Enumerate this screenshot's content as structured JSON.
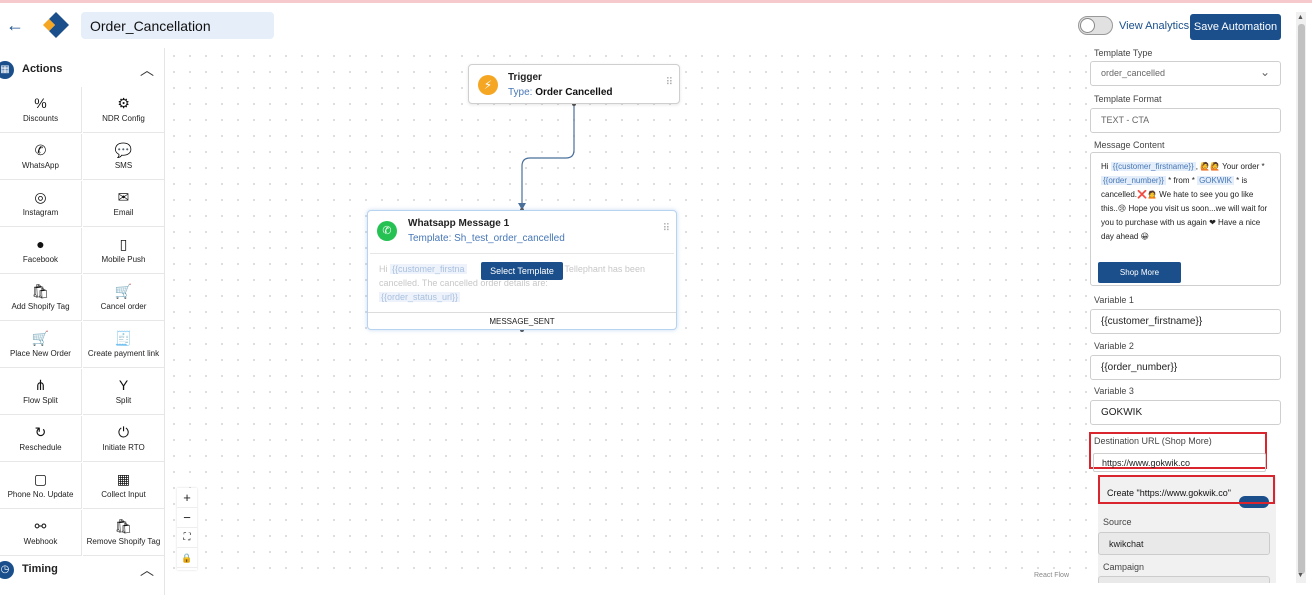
{
  "header": {
    "automation_name": "Order_Cancellation",
    "view_analytics": "View Analytics",
    "save_button": "Save Automation"
  },
  "sidebar": {
    "actions_title": "Actions",
    "timing_title": "Timing",
    "items": [
      {
        "label": "Discounts",
        "icon": "percent-icon"
      },
      {
        "label": "NDR Config",
        "icon": "gear-icon"
      },
      {
        "label": "WhatsApp",
        "icon": "whatsapp-icon"
      },
      {
        "label": "SMS",
        "icon": "sms-icon"
      },
      {
        "label": "Instagram",
        "icon": "instagram-icon"
      },
      {
        "label": "Email",
        "icon": "email-icon"
      },
      {
        "label": "Facebook",
        "icon": "facebook-icon"
      },
      {
        "label": "Mobile Push",
        "icon": "mobile-push-icon"
      },
      {
        "label": "Add Shopify Tag",
        "icon": "shopify-icon"
      },
      {
        "label": "Cancel order",
        "icon": "cart-cancel-icon"
      },
      {
        "label": "Place New Order",
        "icon": "cart-icon"
      },
      {
        "label": "Create payment link",
        "icon": "payment-link-icon"
      },
      {
        "label": "Flow Split",
        "icon": "flow-split-icon"
      },
      {
        "label": "Split",
        "icon": "split-icon"
      },
      {
        "label": "Reschedule",
        "icon": "reschedule-icon"
      },
      {
        "label": "Initiate RTO",
        "icon": "power-icon"
      },
      {
        "label": "Phone No. Update",
        "icon": "phone-update-icon"
      },
      {
        "label": "Collect Input",
        "icon": "grid-icon"
      },
      {
        "label": "Webhook",
        "icon": "webhook-icon"
      },
      {
        "label": "Remove Shopify Tag",
        "icon": "shopify-icon"
      }
    ]
  },
  "canvas": {
    "trigger": {
      "title": "Trigger",
      "type_label": "Type:",
      "type_value": "Order Cancelled"
    },
    "whatsapp_node": {
      "title": "Whatsapp Message 1",
      "template_label": "Template:",
      "template_value": "Sh_test_order_cancelled",
      "body_1": "Hi ",
      "var_1": "{{customer_firstna",
      "body_2": "om Tellephant has been cancelled. The cancelled order details are:",
      "var_2": "{{order_status_url}}",
      "select_button": "Select Template",
      "footer": "MESSAGE_SENT"
    },
    "zoom_controls": [
      "+",
      "−",
      "⛶",
      "🔒"
    ],
    "attribution": "React Flow"
  },
  "panel": {
    "template_type_label": "Template Type",
    "template_type_value": "order_cancelled",
    "template_format_label": "Template Format",
    "template_format_value": "TEXT - CTA",
    "message_content_label": "Message Content",
    "message": {
      "p1": "Hi ",
      "v1": "{{customer_firstname}}",
      "p2": ", 🙋🙋 Your order * ",
      "v2": "{{order_number}}",
      "p3": " * from * ",
      "v3": "GOKWIK",
      "p4": " * is cancelled.❌🙍 We hate to see you go like this..😢 Hope you visit us soon...we will wait for you to purchase with us again ❤ Have a nice day ahead 😀"
    },
    "shop_more_button": "Shop More",
    "variable_1_label": "Variable 1",
    "variable_1_value": "{{customer_firstname}}",
    "variable_2_label": "Variable 2",
    "variable_2_value": "{{order_number}}",
    "variable_3_label": "Variable 3",
    "variable_3_value": "GOKWIK",
    "destination_label": "Destination URL (Shop More)",
    "destination_value": "https://www.gokwik.co",
    "create_option": "Create \"https://www.gokwik.co\"",
    "source_label": "Source",
    "source_value": "kwikchat",
    "campaign_label": "Campaign"
  },
  "colors": {
    "primary": "#1a4f8b",
    "highlight": "#d9252e",
    "whatsapp": "#25c253",
    "trigger": "#f5a623"
  }
}
